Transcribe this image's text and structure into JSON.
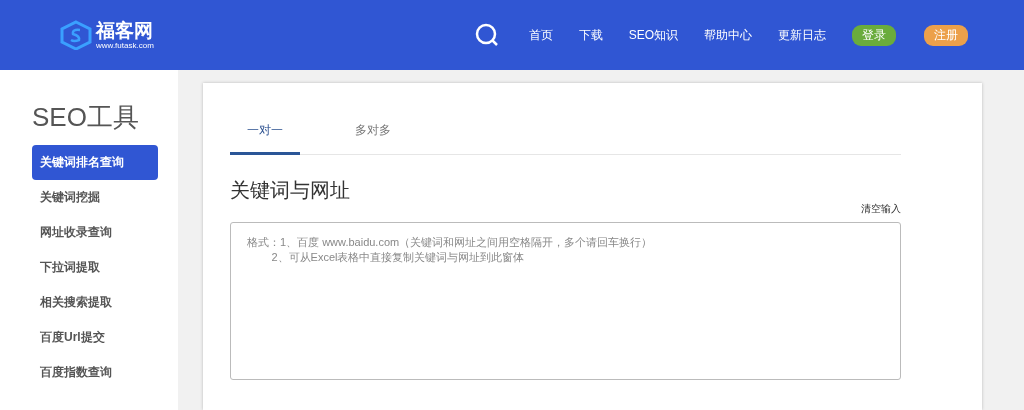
{
  "header": {
    "logo": {
      "name": "福客网",
      "url": "www.futask.com"
    },
    "nav": [
      {
        "label": "首页",
        "kind": "link"
      },
      {
        "label": "下载",
        "kind": "link"
      },
      {
        "label": "SEO知识",
        "kind": "link"
      },
      {
        "label": "帮助中心",
        "kind": "link"
      },
      {
        "label": "更新日志",
        "kind": "link"
      },
      {
        "label": "登录",
        "kind": "login"
      },
      {
        "label": "注册",
        "kind": "register"
      }
    ]
  },
  "sidebar": {
    "title": "SEO工具",
    "items": [
      {
        "label": "关键词排名查询",
        "selected": true
      },
      {
        "label": "关键词挖掘",
        "selected": false
      },
      {
        "label": "网址收录查询",
        "selected": false
      },
      {
        "label": "下拉词提取",
        "selected": false
      },
      {
        "label": "相关搜索提取",
        "selected": false
      },
      {
        "label": "百度Url提交",
        "selected": false
      },
      {
        "label": "百度指数查询",
        "selected": false
      }
    ]
  },
  "main": {
    "tabs": [
      {
        "label": "一对一",
        "selected": true
      },
      {
        "label": "多对多",
        "selected": false
      }
    ],
    "heading": "关键词与网址",
    "clear_link": "清空输入",
    "input": {
      "placeholder": "格式：1、百度 www.baidu.com（关键词和网址之间用空格隔开，多个请回车换行）\n        2、可从Excel表格中直接复制关键词与网址到此窗体"
    }
  }
}
